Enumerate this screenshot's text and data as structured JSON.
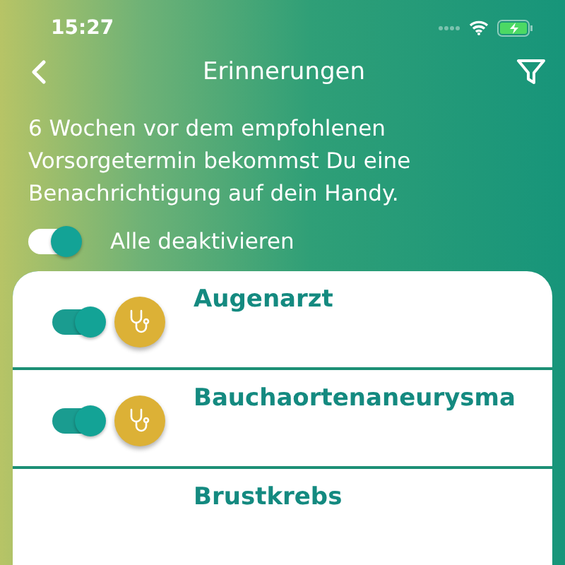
{
  "status_bar": {
    "time": "15:27"
  },
  "nav": {
    "title": "Erinnerungen"
  },
  "intro": "6 Wochen vor dem empfohlenen Vorsorgetermin bekommst Du eine Benachrichtigung auf dein Handy.",
  "master_toggle": {
    "label": "Alle deaktivieren",
    "on": true
  },
  "reminders": [
    {
      "name": "Augenarzt",
      "on": true
    },
    {
      "name": "Bauchaortenaneurysma",
      "on": true
    },
    {
      "name": "Brustkrebs"
    }
  ]
}
